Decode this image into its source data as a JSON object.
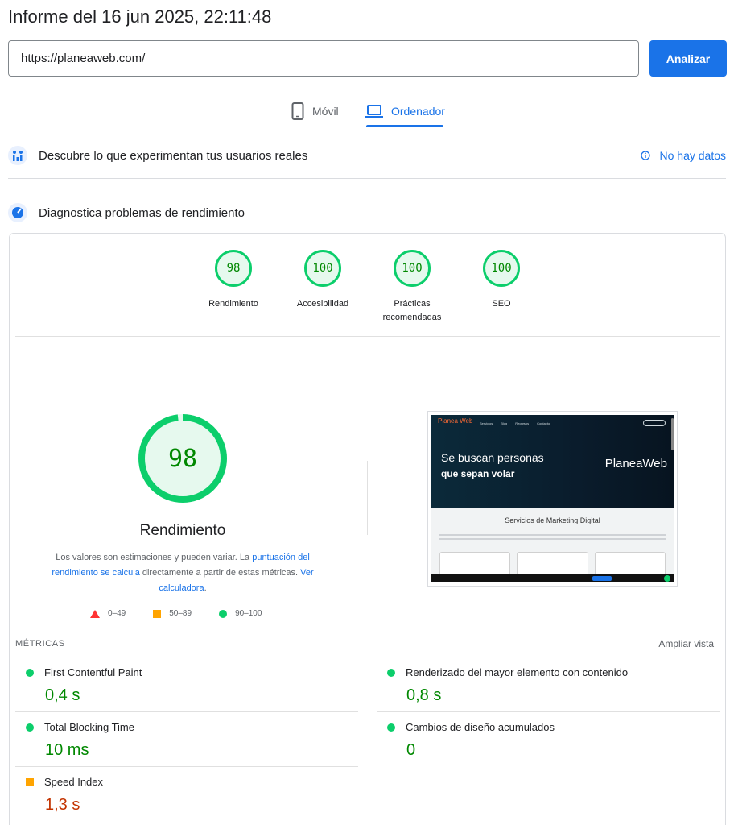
{
  "header": {
    "title": "Informe del 16 jun 2025, 22:11:48"
  },
  "search": {
    "url": "https://planeaweb.com/",
    "button_label": "Analizar"
  },
  "tabs": [
    {
      "label": "Móvil",
      "icon": "smartphone-icon",
      "active": false
    },
    {
      "label": "Ordenador",
      "icon": "laptop-icon",
      "active": true
    }
  ],
  "crux": {
    "title": "Descubre lo que experimentan tus usuarios reales",
    "status": "No hay datos"
  },
  "diagnostics": {
    "title": "Diagnostica problemas de rendimiento",
    "gauges": [
      {
        "score": "98",
        "label": "Rendimiento"
      },
      {
        "score": "100",
        "label": "Accesibilidad"
      },
      {
        "score": "100",
        "label_line1": "Prácticas",
        "label_line2": "recomendadas"
      },
      {
        "score": "100",
        "label": "SEO"
      }
    ],
    "performance": {
      "score": "98",
      "score_fraction": 0.98,
      "label": "Rendimiento",
      "note_prefix": "Los valores son estimaciones y pueden variar. La ",
      "note_link1": "puntuación del rendimiento se calcula",
      "note_middle": " directamente a partir de estas métricas. ",
      "note_link2": "Ver calculadora",
      "note_suffix": "."
    },
    "legend": [
      {
        "range": "0–49",
        "color": "#ff3333",
        "shape": "triangle"
      },
      {
        "range": "50–89",
        "color": "#ffa400",
        "shape": "square"
      },
      {
        "range": "90–100",
        "color": "#0cce6b",
        "shape": "circle"
      }
    ],
    "screenshot": {
      "logo": "Planea Web",
      "nav": [
        "Servicios",
        "Blog",
        "Recursos",
        "Contacto"
      ],
      "headline_line1": "Se buscan personas",
      "headline_line2": "que sepan volar",
      "brand": "PlaneaWeb",
      "section_title": "Servicios de Marketing Digital"
    }
  },
  "metrics": {
    "heading": "MÉTRICAS",
    "expand_label": "Ampliar vista",
    "items": [
      {
        "name": "First Contentful Paint",
        "value": "0,4 s",
        "status": "good"
      },
      {
        "name": "Renderizado del mayor elemento con contenido",
        "value": "0,8 s",
        "status": "good"
      },
      {
        "name": "Total Blocking Time",
        "value": "10 ms",
        "status": "good"
      },
      {
        "name": "Cambios de diseño acumulados",
        "value": "0",
        "status": "good"
      },
      {
        "name": "Speed Index",
        "value": "1,3 s",
        "status": "average"
      }
    ]
  }
}
